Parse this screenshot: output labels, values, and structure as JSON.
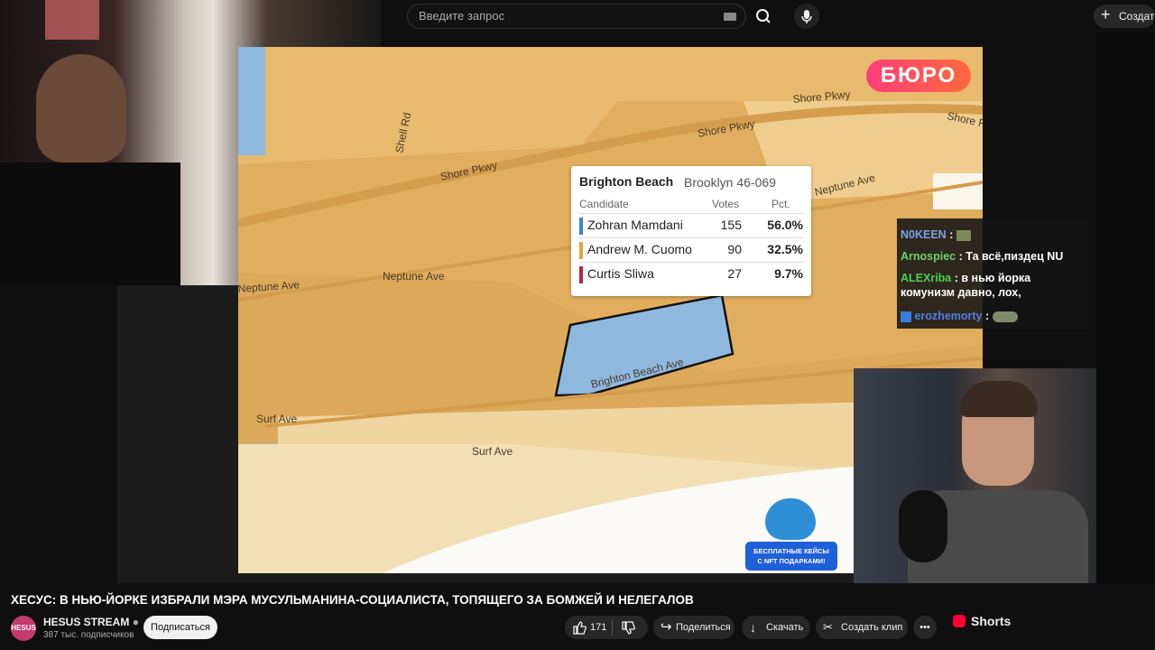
{
  "search": {
    "placeholder": "Введите запрос"
  },
  "header": {
    "create_label": "Создать"
  },
  "map": {
    "logo": "БЮРО",
    "streets": [
      "Shell Rd",
      "Shore Pkwy",
      "Shore Pkwy",
      "Shore Pkwy",
      "Shore Pkwy",
      "Neptune Ave",
      "Neptune Ave",
      "Neptune Ave",
      "Brighton Beach Ave",
      "Surf Ave",
      "Surf Ave"
    ]
  },
  "popup": {
    "title": "Brighton Beach",
    "district": "Brooklyn 46-069",
    "headers": {
      "candidate": "Candidate",
      "votes": "Votes",
      "pct": "Pct."
    },
    "rows": [
      {
        "name": "Zohran Mamdani",
        "votes": "155",
        "pct": "56.0%",
        "color": "#3d86c6"
      },
      {
        "name": "Andrew M. Cuomo",
        "votes": "90",
        "pct": "32.5%",
        "color": "#e2a53e"
      },
      {
        "name": "Curtis Sliwa",
        "votes": "27",
        "pct": "9.7%",
        "color": "#b8283a"
      }
    ]
  },
  "chat": {
    "lines": [
      {
        "user": "N0KEEN",
        "text": ":",
        "user_color": "#7aa0e6"
      },
      {
        "user": "Arnospiec",
        "text": ": Та всё,пиздец NU",
        "user_color": "#6fd06f"
      },
      {
        "user": "ALEXriba",
        "text": ": в нью йорка комунизм давно, лох,",
        "user_color": "#4bd04b"
      },
      {
        "user": "erozhemorty",
        "text": ":",
        "user_color": "#4f7fe0"
      }
    ]
  },
  "promo": {
    "line1": "БЕСПЛАТНЫЕ КЕЙСЫ",
    "line2": "С NFT ПОДАРКАМИ!"
  },
  "video": {
    "title": "ХЕСУС: В НЬЮ-ЙОРКЕ ИЗБРАЛИ МЭРА МУСУЛЬМАНИНА-СОЦИАЛИСТА, ТОПЯЩЕГО ЗА БОМЖЕЙ И НЕЛЕГАЛОВ",
    "channel": "HESUS STREAM",
    "avatar_text": "HESUS",
    "subscribers": "387 тыс. подписчиков",
    "subscribe_label": "Подписаться",
    "likes": "171",
    "share_label": "Поделиться",
    "download_label": "Скачать",
    "clip_label": "Создать клип"
  },
  "sidebar": {
    "shorts_label": "Shorts",
    "ghost_shorts": "Shorts"
  },
  "colors": {
    "accent": "#ff0033",
    "map_base": "#e7b768",
    "water": "#8fb8df"
  }
}
